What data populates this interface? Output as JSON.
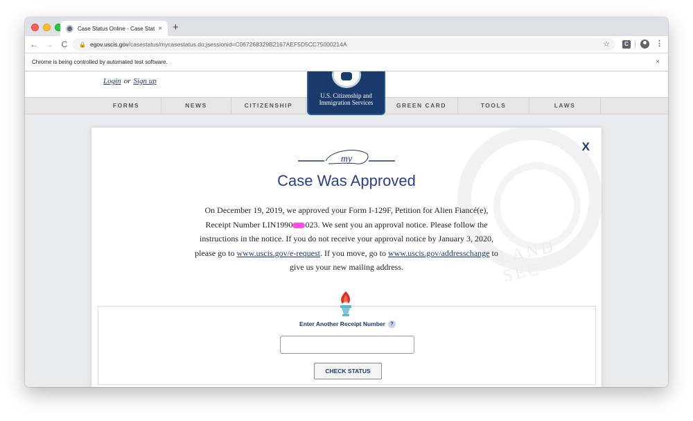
{
  "browser": {
    "tab_title": "Case Status Online - Case Stat",
    "tab_close": "×",
    "new_tab": "+",
    "url_domain": "egov.uscis.gov",
    "url_rest": "/casestatus/mycasestatus.do;jsessionid=C067268329B2167AEF5D5CC75000214A",
    "back": "←",
    "forward": "→",
    "reload": "C",
    "lock": "🔒",
    "star": "☆",
    "ext_label": "C",
    "menu": "⋮",
    "infobar_text": "Chrome is being controlled by automated test software.",
    "infobar_close": "×"
  },
  "header": {
    "login": "Login",
    "or": "or",
    "signup": "Sign up",
    "logo_line1": "U.S. Citizenship and",
    "logo_line2": "Immigration Services"
  },
  "nav": {
    "items": [
      "FORMS",
      "NEWS",
      "CITIZENSHIP",
      "GREEN CARD",
      "TOOLS",
      "LAWS"
    ]
  },
  "modal": {
    "close": "X",
    "ornament_text": "my",
    "title": "Case Was Approved",
    "body_1": "On December 19, 2019, we approved your Form I-129F, Petition for Alien Fiancé(e), Receipt Number LIN1990",
    "body_2": "023. We sent you an approval notice. Please follow the instructions in the notice. If you do not receive your approval notice by January 3, 2020, please go to ",
    "link_erequest": "www.uscis.gov/e-request",
    "body_3": ". If you move, go to ",
    "link_address": "www.uscis.gov/addresschange",
    "body_4": " to give us your new mailing address.",
    "watermark": "LAND SEC"
  },
  "receipt": {
    "label": "Enter Another Receipt Number",
    "help": "?",
    "input_value": "",
    "button": "CHECK STATUS"
  },
  "colors": {
    "brand_navy": "#1b3770",
    "title_blue": "#2b3f87",
    "logo_bg": "#1a3a6b",
    "redaction": "#ff4de1"
  }
}
